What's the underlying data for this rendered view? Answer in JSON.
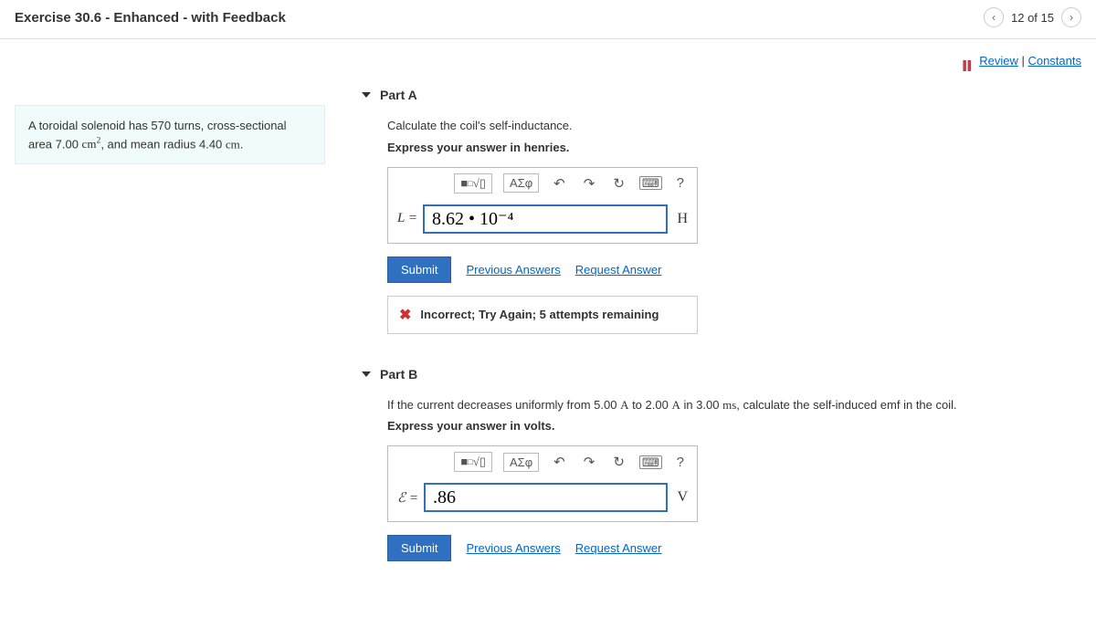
{
  "header": {
    "title": "Exercise 30.6 - Enhanced - with Feedback",
    "pager_text": "12 of 15"
  },
  "utilities": {
    "review": "Review",
    "constants": "Constants"
  },
  "problem": {
    "text_before_sup": "A toroidal solenoid has 570 turns, cross-sectional area 7.00 ",
    "unit_base": "cm",
    "unit_exp": "2",
    "text_after_sup": ", and mean radius 4.40 ",
    "radius_unit": "cm",
    "text_end": "."
  },
  "partA": {
    "label": "Part A",
    "prompt1": "Calculate the coil's self-inductance.",
    "prompt2": "Express your answer in henries.",
    "greek_label": "ΑΣφ",
    "help_q": "?",
    "lhs_var": "L",
    "lhs_eq": " = ",
    "input_value": "8.62 • 10⁻⁴",
    "unit": "H",
    "submit": "Submit",
    "prev": "Previous Answers",
    "request": "Request Answer",
    "feedback": "Incorrect; Try Again; 5 attempts remaining"
  },
  "partB": {
    "label": "Part B",
    "prompt1_a": "If the current decreases uniformly from 5.00 ",
    "unit_A1": "A",
    "prompt1_b": " to 2.00 ",
    "unit_A2": "A",
    "prompt1_c": " in 3.00 ",
    "unit_ms": "ms",
    "prompt1_d": ", calculate the self-induced emf in the coil.",
    "prompt2": "Express your answer in volts.",
    "greek_label": "ΑΣφ",
    "help_q": "?",
    "lhs_var": "ℰ",
    "lhs_eq": " = ",
    "input_value": ".86",
    "unit": "V",
    "submit": "Submit",
    "prev": "Previous Answers",
    "request": "Request Answer"
  }
}
